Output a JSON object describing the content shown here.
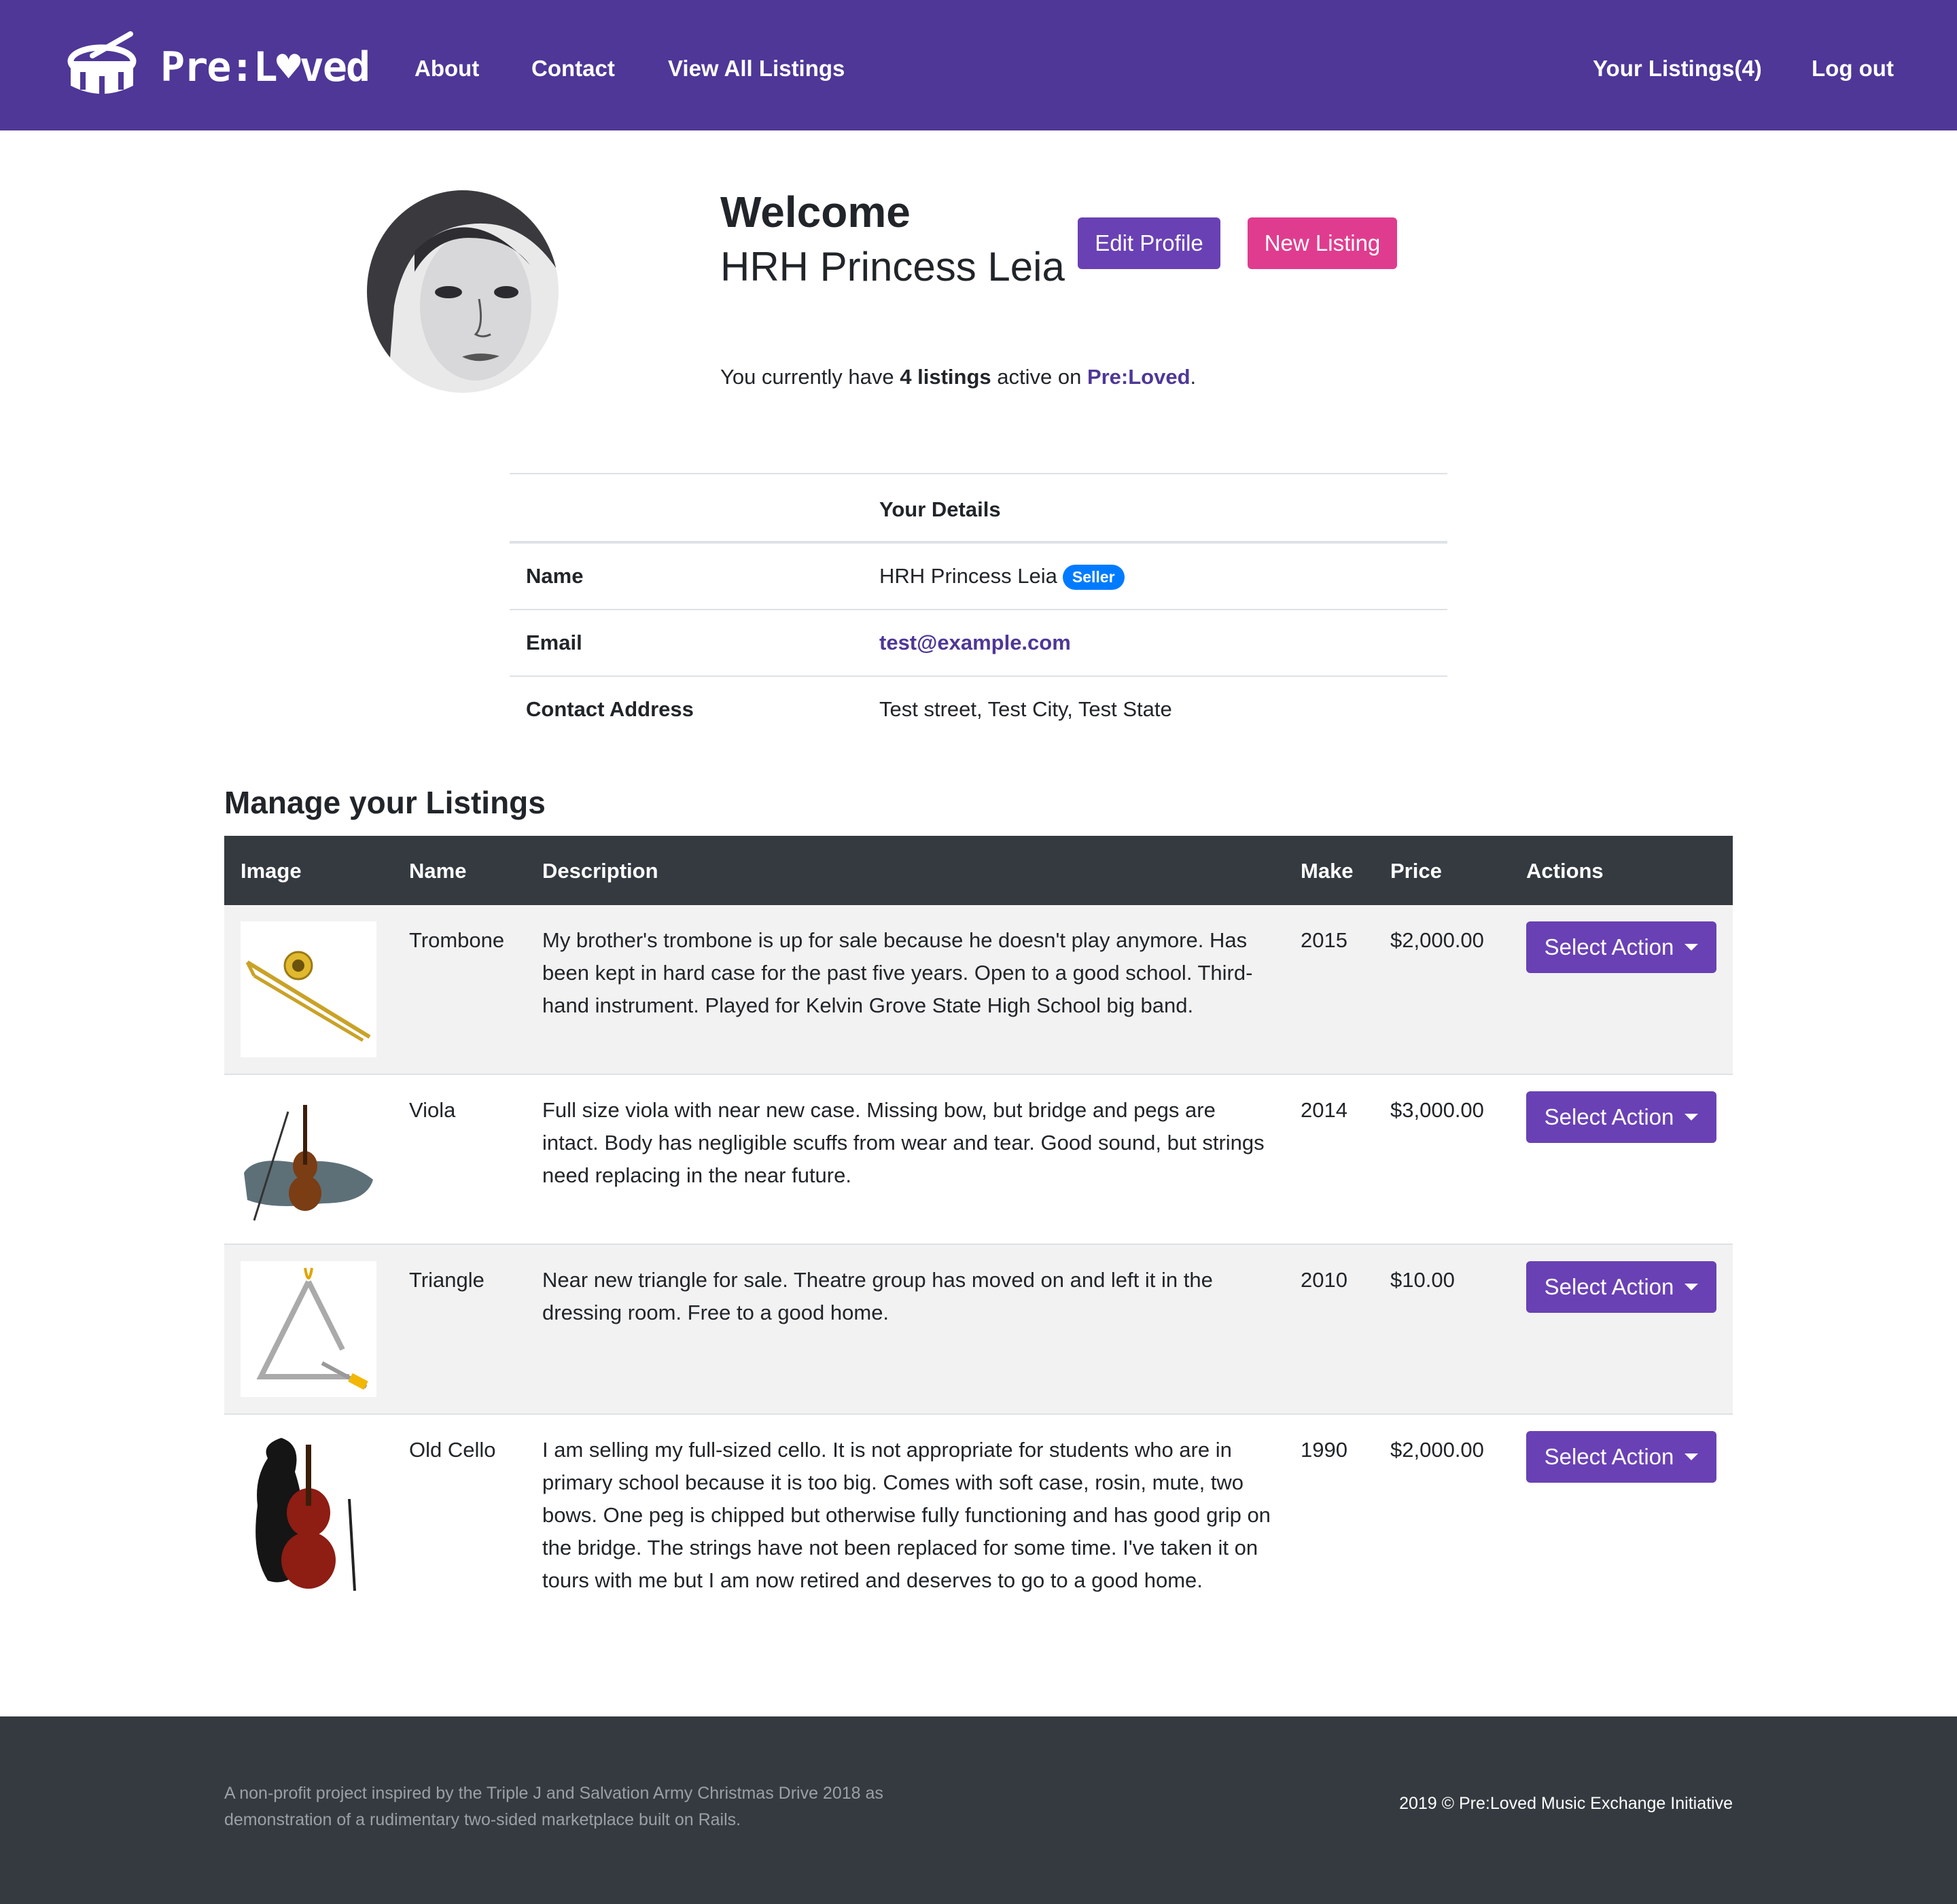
{
  "colors": {
    "navbar": "#4e3797",
    "primary_button": "#6941b4",
    "new_listing_button": "#e03c8f",
    "table_header": "#343a40",
    "footer": "#343a40",
    "badge": "#007bff"
  },
  "navbar": {
    "brand_icon": "drum-icon",
    "brand_name": "Pre:L♥ved",
    "links": [
      "About",
      "Contact",
      "View All Listings"
    ],
    "your_listings": "Your Listings(4)",
    "logout": "Log out"
  },
  "profile": {
    "avatar_icon": "user-portrait-avatar",
    "welcome": "Welcome",
    "name": "HRH Princess Leia",
    "edit_button": "Edit Profile",
    "new_listing_button": "New Listing",
    "summary_prefix": "You currently have ",
    "summary_count": "4 listings",
    "summary_middle": " active on ",
    "summary_brand": "Pre:Loved",
    "summary_suffix": "."
  },
  "details": {
    "heading": "Your Details",
    "rows": [
      {
        "label": "Name",
        "value": "HRH Princess Leia",
        "badge": "Seller"
      },
      {
        "label": "Email",
        "value": "test@example.com"
      },
      {
        "label": "Contact Address",
        "value": "Test street, Test City, Test State"
      }
    ]
  },
  "listings": {
    "title": "Manage your Listings",
    "columns": [
      "Image",
      "Name",
      "Description",
      "Make",
      "Price",
      "Actions"
    ],
    "rows": [
      {
        "image": "trombone-image",
        "name": "Trombone",
        "description": "My brother's trombone is up for sale because he doesn't play anymore. Has been kept in hard case for the past five years. Open to a good school. Third-hand instrument. Played for Kelvin Grove State High School big band.",
        "make": "2015",
        "price": "$2,000.00",
        "action": "Select Action"
      },
      {
        "image": "viola-image",
        "name": "Viola",
        "description": "Full size viola with near new case. Missing bow, but bridge and pegs are intact. Body has negligible scuffs from wear and tear. Good sound, but strings need replacing in the near future.",
        "make": "2014",
        "price": "$3,000.00",
        "action": "Select Action"
      },
      {
        "image": "triangle-image",
        "name": "Triangle",
        "description": "Near new triangle for sale. Theatre group has moved on and left it in the dressing room. Free to a good home.",
        "make": "2010",
        "price": "$10.00",
        "action": "Select Action"
      },
      {
        "image": "cello-image",
        "name": "Old Cello",
        "description": "I am selling my full-sized cello. It is not appropriate for students who are in primary school because it is too big. Comes with soft case, rosin, mute, two bows. One peg is chipped but otherwise fully functioning and has good grip on the bridge. The strings have not been replaced for some time. I've taken it on tours with me but I am now retired and deserves to go to a good home.",
        "make": "1990",
        "price": "$2,000.00",
        "action": "Select Action"
      }
    ]
  },
  "footer": {
    "about": "A non-profit project inspired by the Triple J and Salvation Army Christmas Drive 2018 as demonstration of a rudimentary two-sided marketplace built on Rails.",
    "copyright": "2019 © Pre:Loved Music Exchange Initiative"
  }
}
